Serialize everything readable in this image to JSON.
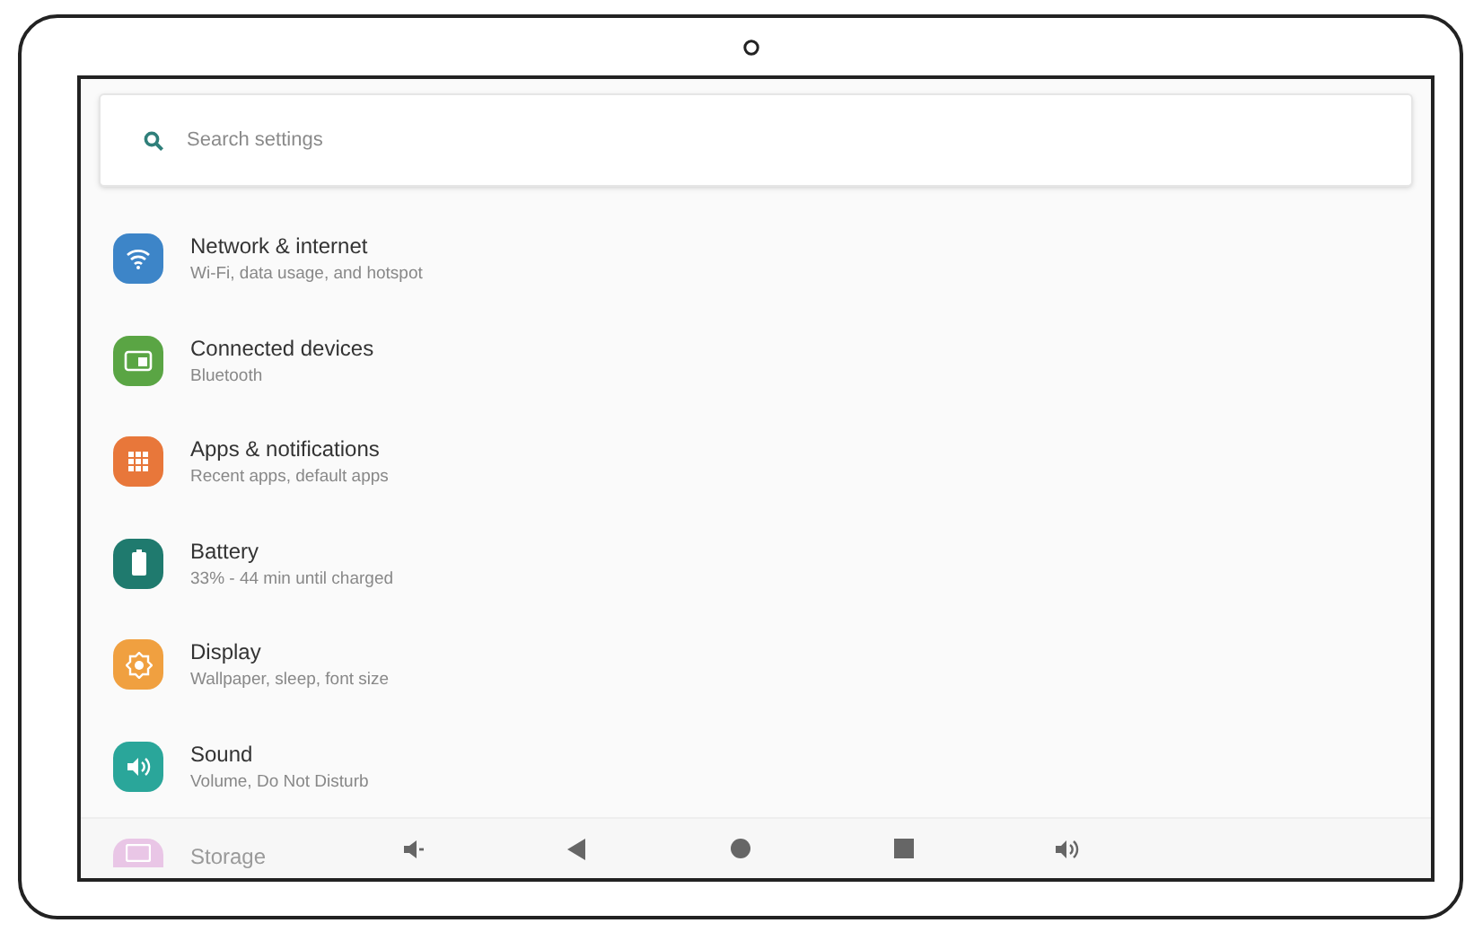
{
  "search": {
    "placeholder": "Search settings"
  },
  "items": [
    {
      "title": "Network & internet",
      "subtitle": "Wi-Fi, data usage, and hotspot",
      "kind": "wifi",
      "color": "#3d85c8"
    },
    {
      "title": "Connected devices",
      "subtitle": "Bluetooth",
      "kind": "devices",
      "color": "#5aa544"
    },
    {
      "title": "Apps & notifications",
      "subtitle": "Recent apps, default apps",
      "kind": "apps",
      "color": "#e8773a"
    },
    {
      "title": "Battery",
      "subtitle": "33% - 44 min until charged",
      "kind": "battery",
      "color": "#1f7a6e"
    },
    {
      "title": "Display",
      "subtitle": "Wallpaper, sleep, font size",
      "kind": "display",
      "color": "#f0a040"
    },
    {
      "title": "Sound",
      "subtitle": "Volume, Do Not Disturb",
      "kind": "sound",
      "color": "#2aa69a"
    },
    {
      "title": "Storage",
      "kind": "storage",
      "color": "#e9c6e6"
    }
  ]
}
